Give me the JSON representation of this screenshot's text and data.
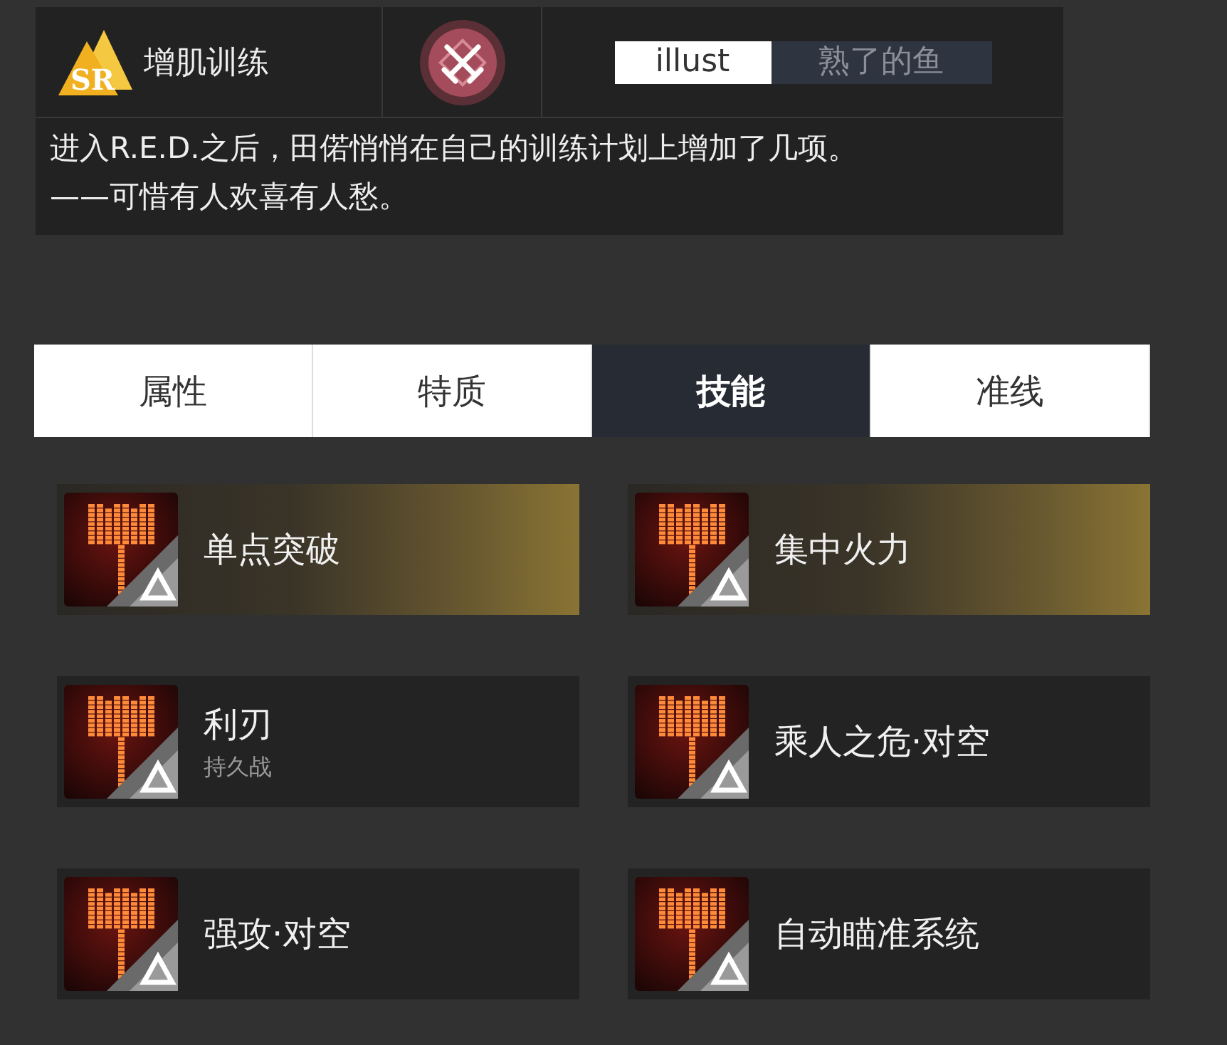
{
  "header": {
    "rarity": "SR",
    "title": "增肌训练",
    "illust_label": "illust",
    "illustrator": "熟了的鱼",
    "description": "进入R.E.D.之后，田偌悄悄在自己的训练计划上增加了几项。\n——可惜有人欢喜有人愁。"
  },
  "tabs": [
    {
      "label": "属性",
      "selected": false
    },
    {
      "label": "特质",
      "selected": false
    },
    {
      "label": "技能",
      "selected": true
    },
    {
      "label": "准线",
      "selected": false
    }
  ],
  "skills": [
    {
      "name": "单点突破",
      "highlighted": true
    },
    {
      "name": "集中火力",
      "highlighted": true
    },
    {
      "name": "利刃",
      "subtitle": "持久战",
      "highlighted": false
    },
    {
      "name": "乘人之危·对空",
      "highlighted": false
    },
    {
      "name": "强攻·对空",
      "highlighted": false
    },
    {
      "name": "自动瞄准系统",
      "highlighted": false
    }
  ]
}
